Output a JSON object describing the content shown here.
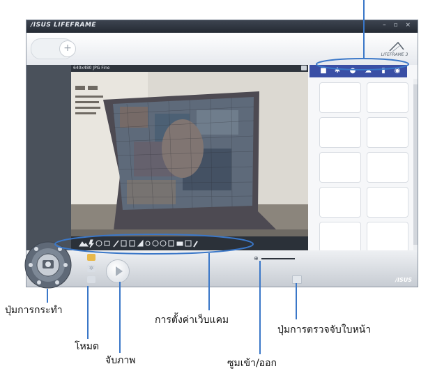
{
  "app": {
    "brand": "/ISUS LIFEFRAME",
    "window_buttons": "– ▫ ×",
    "logo_text": "LIFEFRAME 3",
    "preview_resolution": "640x480 JPG Fine",
    "bottom_logo": "/ISUS",
    "media_tabs": [
      "camera-icon",
      "settings-icon",
      "face-icon",
      "cloud-icon",
      "microphone-icon",
      "eye-icon"
    ]
  },
  "annotations": {
    "action_button": "ปุ่มการกระทำ",
    "mode": "โหมด",
    "capture": "จับภาพ",
    "webcam_settings": "การตั้งค่าเว็บแคม",
    "zoom": "ซูมเข้า/ออก",
    "face_detect": "ปุ่มการตรวจจับใบหน้า"
  },
  "colors": {
    "callout": "#3a77c8",
    "tab_bar": "#3a4fa5"
  }
}
